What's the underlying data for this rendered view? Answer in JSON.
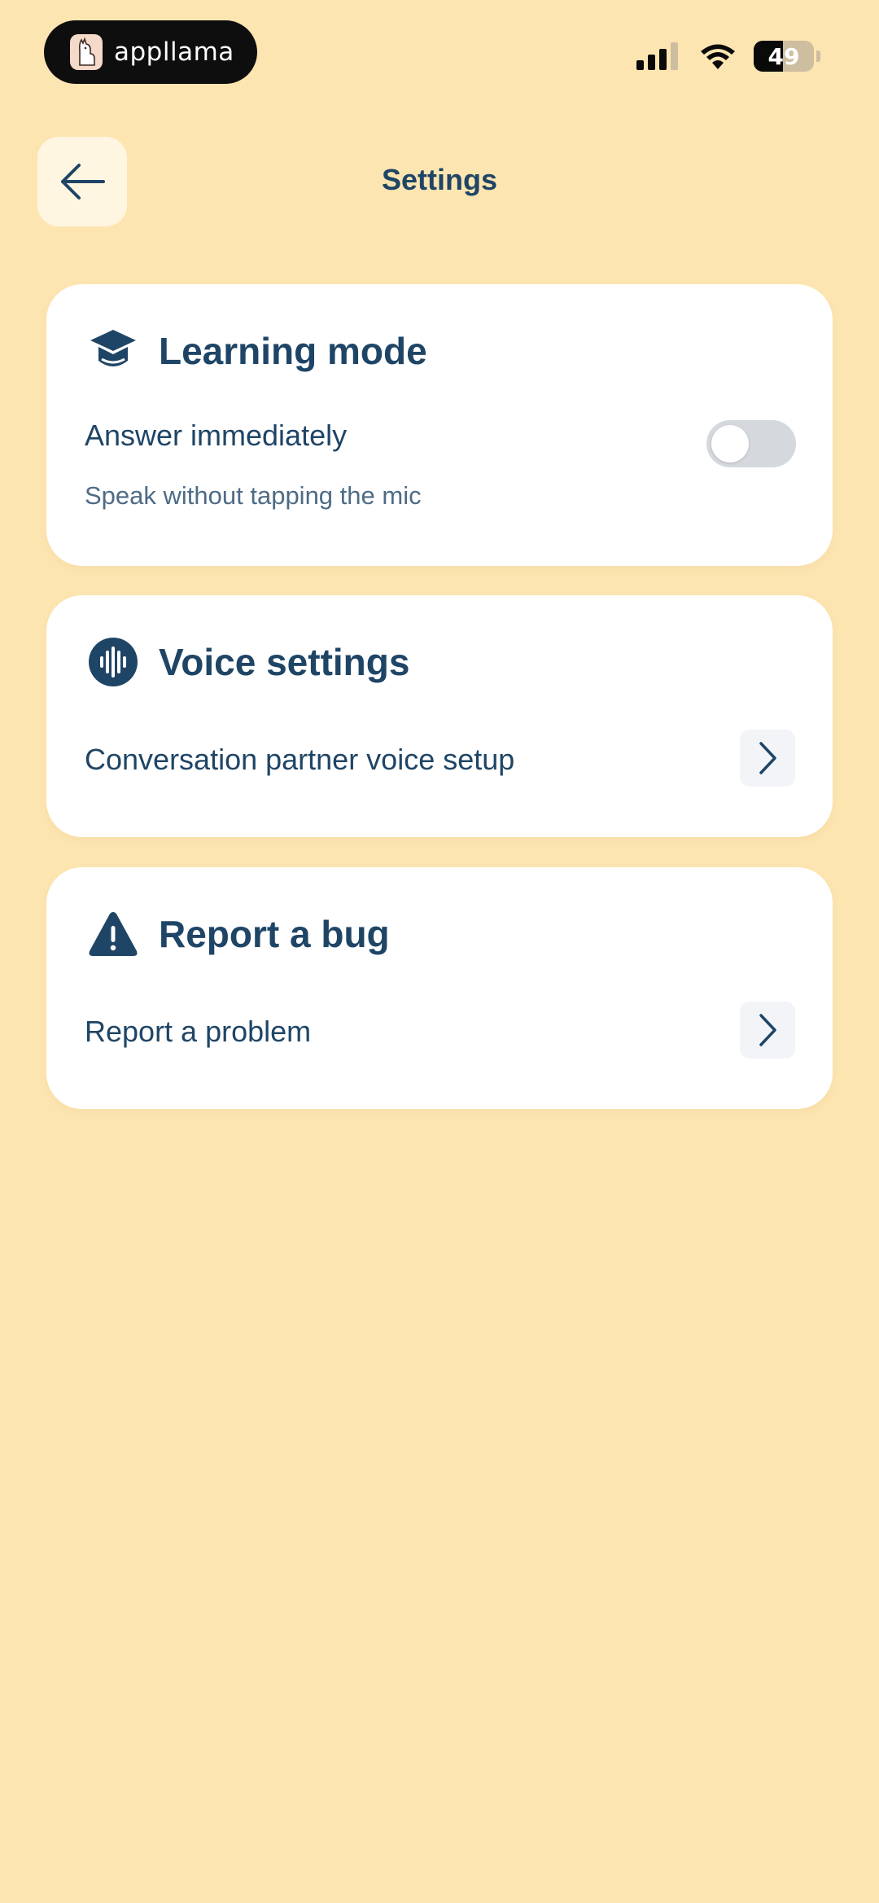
{
  "status_bar": {
    "app_name": "appllama",
    "battery_level": "49",
    "battery_fraction": 0.49,
    "app_logo_icon": "llama-logo-icon",
    "signal_icon": "cellular-signal-icon",
    "wifi_icon": "wifi-icon"
  },
  "header": {
    "title": "Settings",
    "back_icon": "arrow-left-icon"
  },
  "learning_mode": {
    "title": "Learning mode",
    "icon": "graduation-cap-icon",
    "option_label": "Answer immediately",
    "option_description": "Speak without tapping the mic",
    "toggle_on": false
  },
  "voice_settings": {
    "title": "Voice settings",
    "icon": "voice-waveform-icon",
    "row_label": "Conversation partner voice setup",
    "chevron_icon": "chevron-right-icon"
  },
  "report_bug": {
    "title": "Report a bug",
    "icon": "warning-triangle-icon",
    "row_label": "Report a problem",
    "chevron_icon": "chevron-right-icon"
  },
  "colors": {
    "background": "#FDE5B1",
    "primary_text": "#1F4566",
    "card": "#FFFFFF",
    "toggle_off": "#D5D8DC"
  }
}
